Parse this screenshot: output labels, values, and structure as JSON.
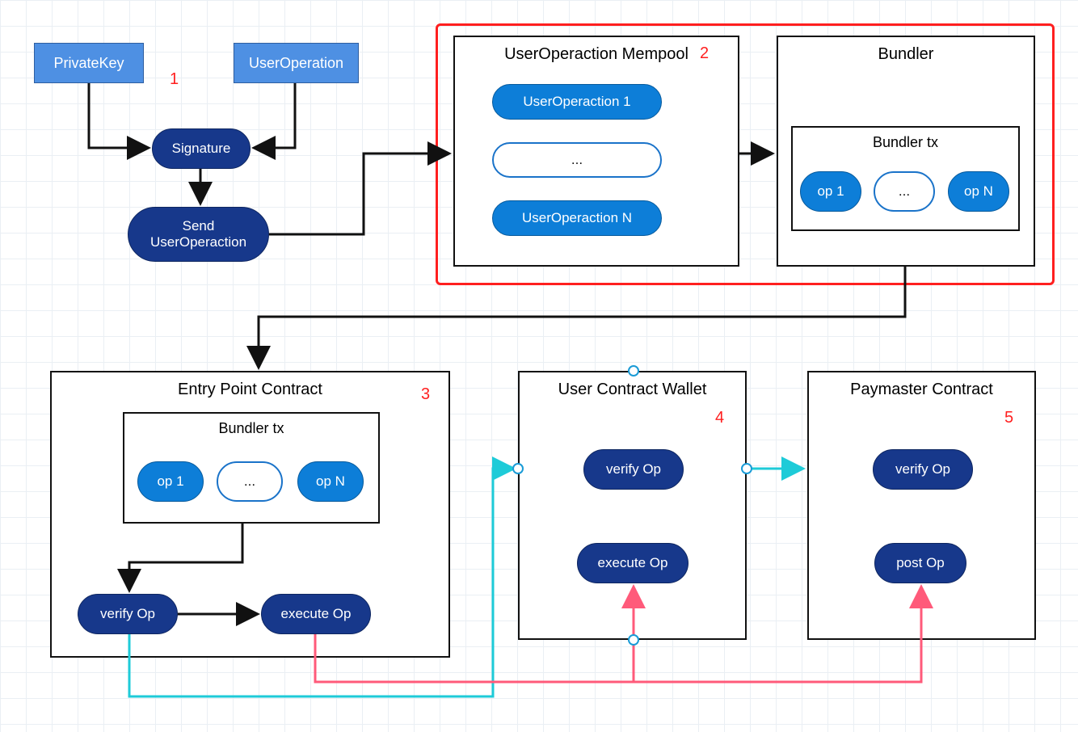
{
  "top": {
    "privateKey": "PrivateKey",
    "userOperation": "UserOperation",
    "signature": "Signature",
    "send_line1": "Send",
    "send_line2": "UserOperaction"
  },
  "annotations": {
    "one": "1",
    "two": "2",
    "three": "3",
    "four": "4",
    "five": "5"
  },
  "mempool": {
    "title": "UserOperaction Mempool",
    "item1": "UserOperaction 1",
    "dots": "...",
    "itemN": "UserOperaction N"
  },
  "bundler": {
    "title": "Bundler",
    "tx_title": "Bundler tx",
    "op1": "op 1",
    "dots": "...",
    "opN": "op N"
  },
  "epc": {
    "title": "Entry Point Contract",
    "tx_title": "Bundler tx",
    "op1": "op 1",
    "dots": "...",
    "opN": "op N",
    "verify": "verify Op",
    "execute": "execute Op"
  },
  "ucw": {
    "title": "User Contract Wallet",
    "verify": "verify Op",
    "execute": "execute Op"
  },
  "pmc": {
    "title": "Paymaster Contract",
    "verify": "verify Op",
    "post": "post Op"
  }
}
